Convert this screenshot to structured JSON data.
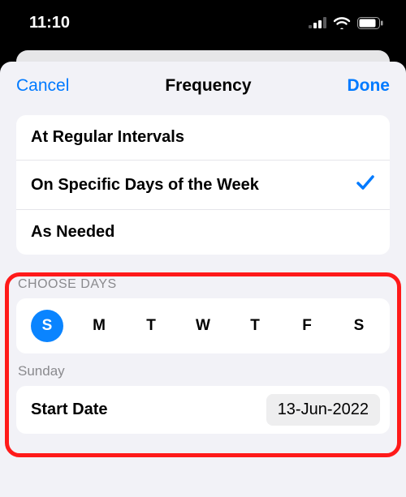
{
  "status": {
    "time": "11:10"
  },
  "nav": {
    "cancel": "Cancel",
    "title": "Frequency",
    "done": "Done"
  },
  "options": {
    "regular": "At Regular Intervals",
    "specific": "On Specific Days of the Week",
    "as_needed": "As Needed"
  },
  "sections": {
    "choose_days": "CHOOSE DAYS",
    "selected_day_name": "Sunday"
  },
  "days": {
    "sun": "S",
    "mon": "M",
    "tue": "T",
    "wed": "W",
    "thu": "T",
    "fri": "F",
    "sat": "S"
  },
  "start_date": {
    "label": "Start Date",
    "value": "13-Jun-2022"
  }
}
